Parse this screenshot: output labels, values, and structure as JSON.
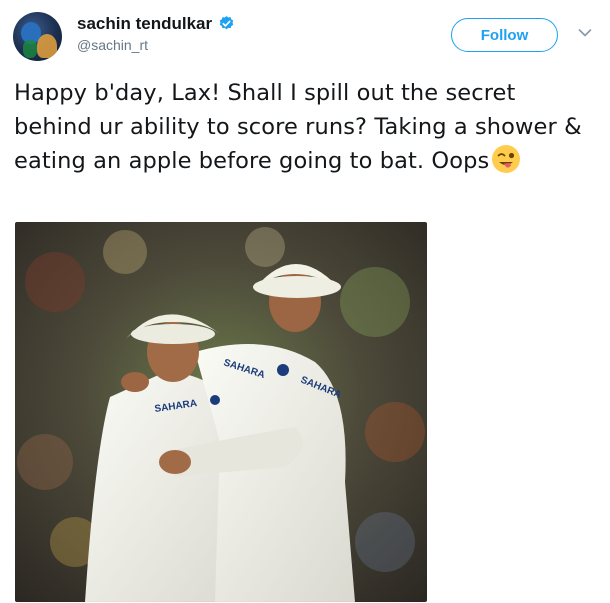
{
  "author": {
    "name": "sachin tendulkar",
    "handle": "@sachin_rt",
    "verified": true,
    "avatar_icon": "profile-avatar"
  },
  "actions": {
    "follow_label": "Follow",
    "more_icon": "chevron-down-icon"
  },
  "tweet": {
    "text": "Happy b'day, Lax! Shall I spill out the secret behind ur ability to score runs? Taking a shower & eating an apple before going to bat. Oops",
    "emoji": "winking-face-with-tongue"
  },
  "media": {
    "jersey_text_left": "SAHARA",
    "jersey_text_right": "SAHARA",
    "jersey_text_chest": "SAHARA"
  },
  "colors": {
    "accent": "#1da1f2",
    "text": "#14171a",
    "muted": "#657786"
  }
}
